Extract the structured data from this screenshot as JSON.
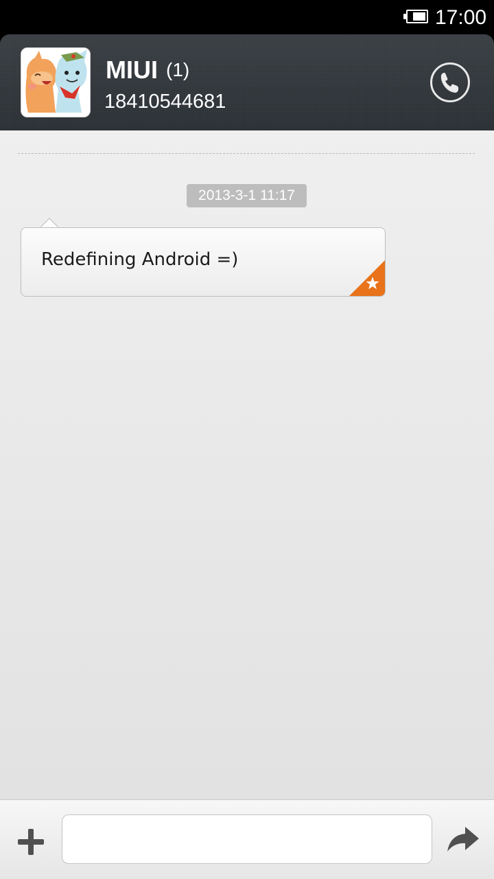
{
  "status_bar": {
    "time": "17:00",
    "battery_icon": "battery-icon"
  },
  "header": {
    "contact_name": "MIUI",
    "unread_count": "(1)",
    "phone_number": "18410544681",
    "call_icon": "phone-icon"
  },
  "conversation": {
    "timestamp": "2013-3-1 11:17",
    "messages": [
      {
        "text": "Redefining Android =)",
        "starred": true
      }
    ]
  },
  "compose": {
    "add_icon": "plus-icon",
    "input_value": "",
    "send_icon": "send-arrow-icon"
  },
  "colors": {
    "header_bg": "#2f3439",
    "star_accent": "#e8731a",
    "timestamp_bg": "#bdbdbd"
  }
}
